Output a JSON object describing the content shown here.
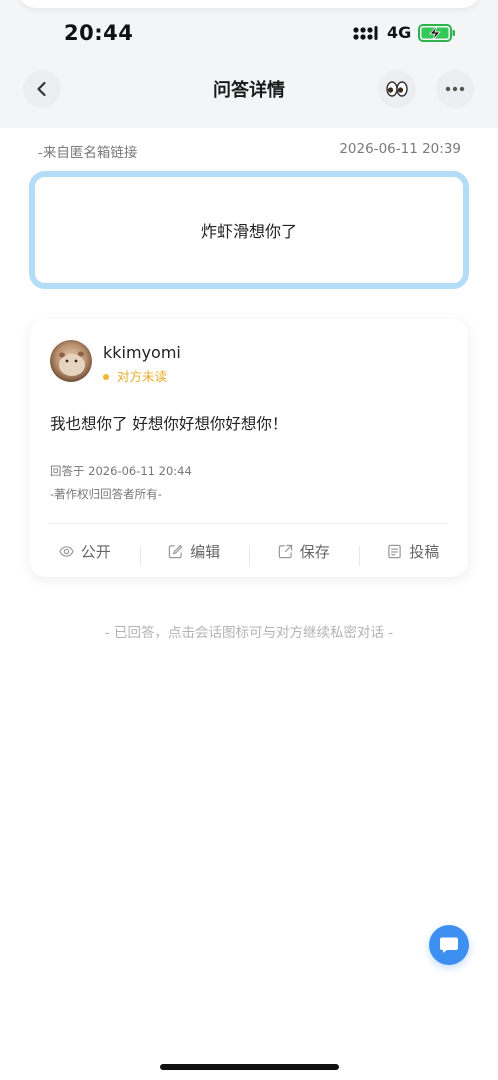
{
  "status_bar": {
    "time": "20:44",
    "network": "4G",
    "icons": [
      "signal-icon",
      "battery-charging-icon"
    ]
  },
  "nav": {
    "title": "问答详情",
    "icons": [
      "back-chevron-icon",
      "eyes-icon",
      "more-dots-icon"
    ]
  },
  "meta": {
    "source": "-来自匿名箱链接",
    "timestamp": "2026-06-11 20:39"
  },
  "question": {
    "text": "炸虾滑想你了"
  },
  "answer": {
    "username": "kkimyomi",
    "read_status": "对方未读",
    "text": "我也想你了 好想你好想你好想你！",
    "answered_at": "回答于 2026-06-11 20:44",
    "copyright": "-著作权归回答者所有-"
  },
  "actions": [
    {
      "label": "公开",
      "icon": "eye-icon"
    },
    {
      "label": "编辑",
      "icon": "edit-icon"
    },
    {
      "label": "保存",
      "icon": "save-icon"
    },
    {
      "label": "投稿",
      "icon": "submit-icon"
    }
  ],
  "footer_hint": "- 已回答，点击会话图标可与对方继续私密对话 -",
  "colors": {
    "accent": "#3d8ff1",
    "question_border": "#b3dcf7",
    "unread_status": "#e8ad2c"
  }
}
